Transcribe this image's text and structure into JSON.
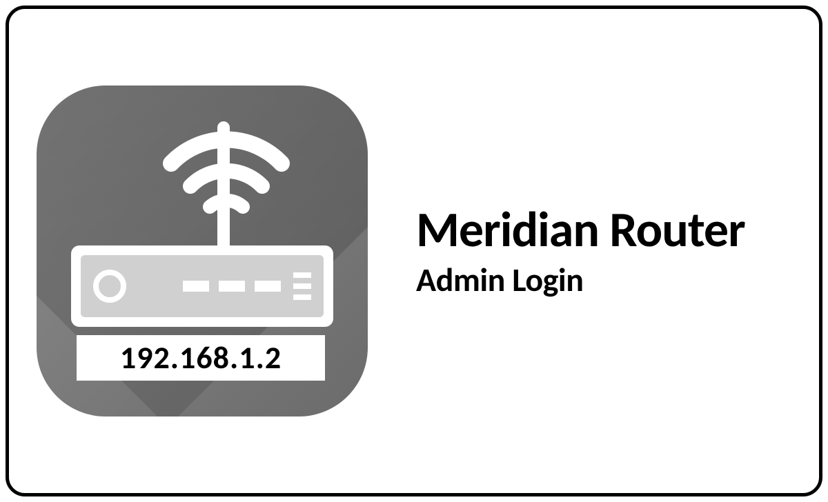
{
  "title": "Meridian Router",
  "subtitle": "Admin Login",
  "ip_address": "192.168.1.2"
}
